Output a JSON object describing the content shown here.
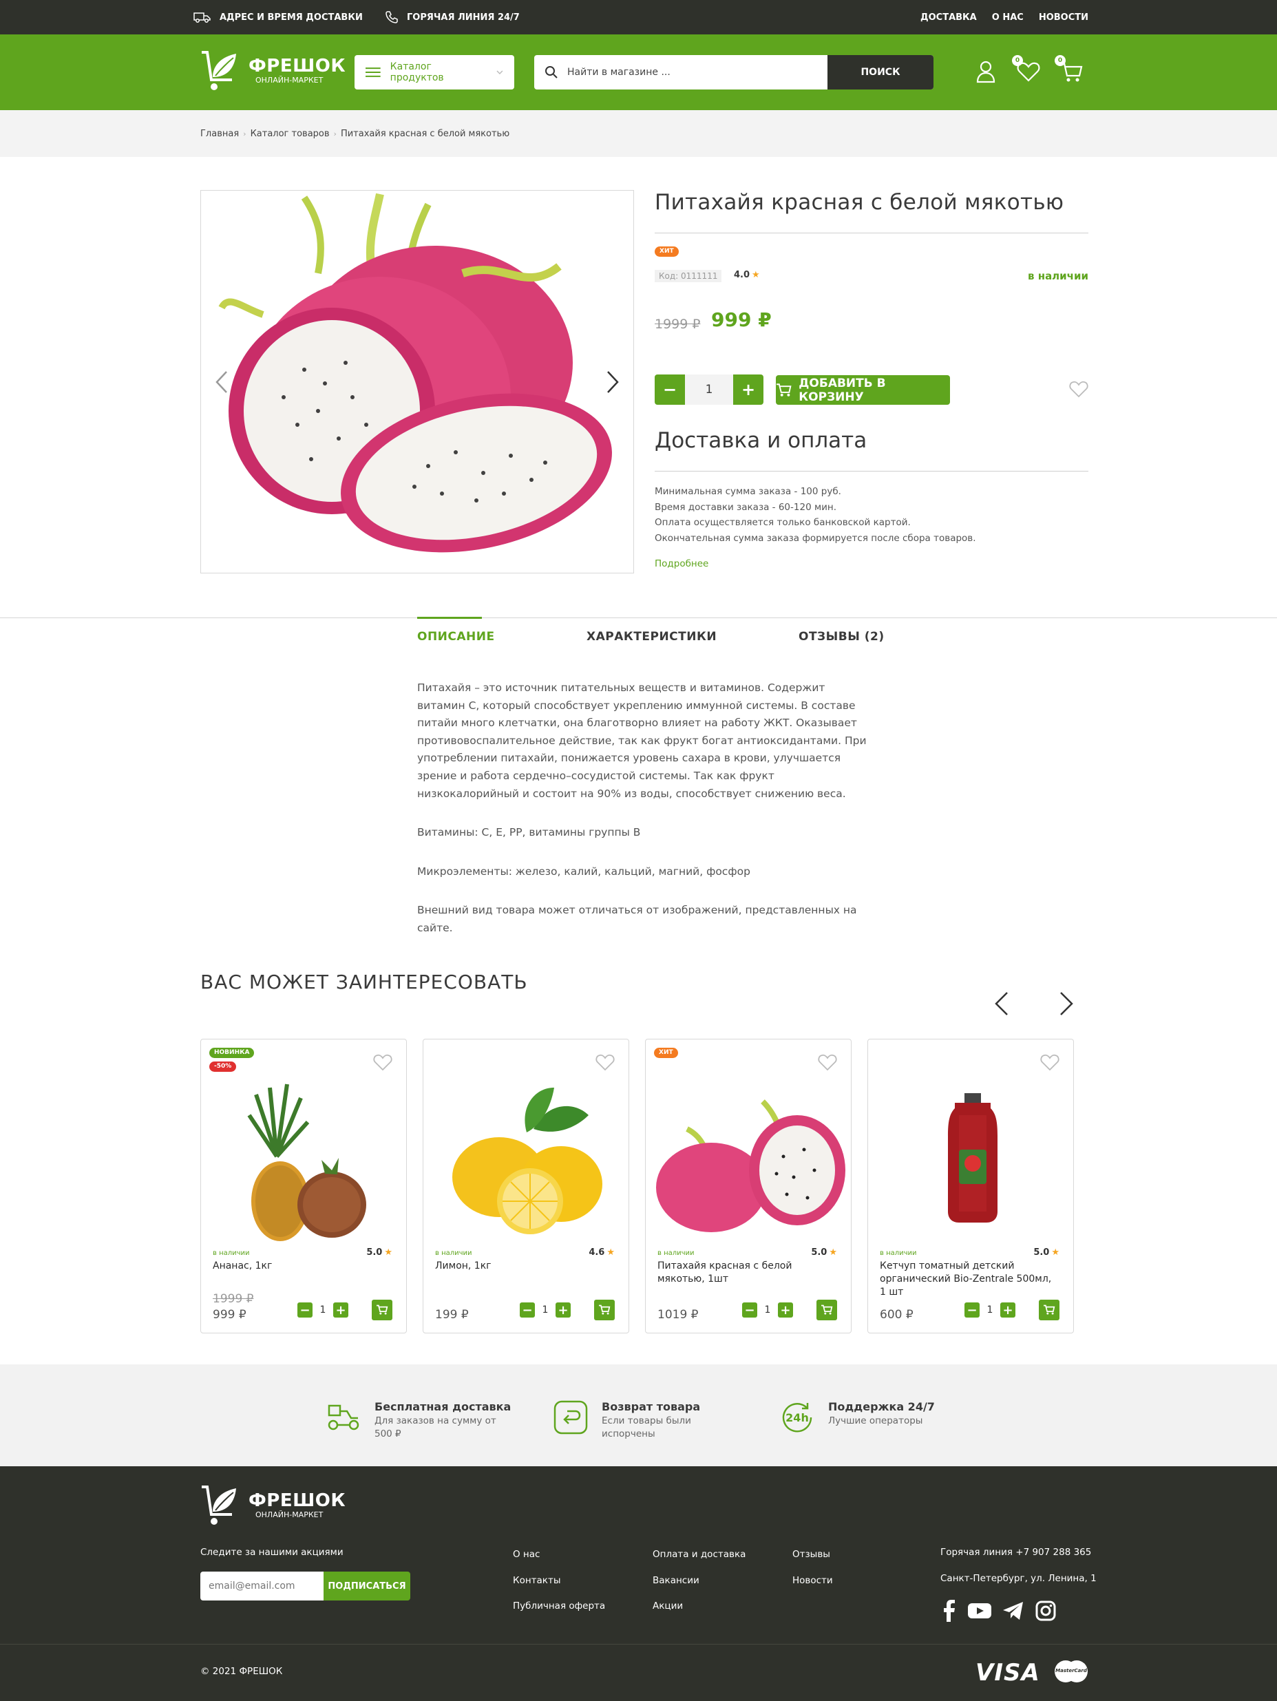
{
  "topbar": {
    "delivery_info": "АДРЕС И ВРЕМЯ ДОСТАВКИ",
    "hotline": "ГОРЯЧАЯ ЛИНИЯ 24/7",
    "nav": [
      "ДОСТАВКА",
      "О НАС",
      "НОВОСТИ"
    ]
  },
  "header": {
    "logo_title": "ФРЕШОК",
    "logo_subtitle": "ОНЛАЙН-МАРКЕТ",
    "catalog_label": "Каталог продуктов",
    "search_placeholder": "Найти в магазине ...",
    "search_button": "ПОИСК",
    "favorites_count": "0",
    "cart_count": "0"
  },
  "breadcrumb": [
    "Главная",
    "Каталог товаров",
    "Питахайя красная с белой мякотью"
  ],
  "product": {
    "title": "Питахайя красная с белой мякотью",
    "badge": "ХИТ",
    "code": "Код: 0111111",
    "rating": "4.0",
    "availability": "в наличии",
    "old_price": "1999 ₽",
    "price": "999 ₽",
    "quantity": "1",
    "add_to_cart": "ДОБАВИТЬ В КОРЗИНУ"
  },
  "delivery": {
    "title": "Доставка и оплата",
    "lines": [
      "Минимальная сумма заказа - 100 руб.",
      "Время доставки заказа - 60-120 мин.",
      "Оплата осуществляется только банковской картой.",
      "Окончательная сумма заказа формируется после сбора товаров."
    ],
    "more": "Подробнее"
  },
  "tabs": [
    "ОПИСАНИЕ",
    "ХАРАКТЕРИСТИКИ",
    "ОТЗЫВЫ (2)"
  ],
  "description": {
    "p1": "Питахайя – это источник питательных веществ и витаминов. Содержит витамин С, который способствует укреплению иммунной системы. В составе питайи много клетчатки, она благотворно влияет на работу ЖКТ. Оказывает противовоспалительное действие, так как фрукт богат антиоксидантами. При употреблении питахайи, понижается уровень сахара в крови, улучшается зрение и работа сердечно–сосудистой системы. Так как фрукт низкокалорийный и состоит на 90% из воды, способствует снижению веса.",
    "p2": "Витамины: С, Е, РР, витамины группы В",
    "p3": "Микроэлементы: железо, калий, кальций, магний, фосфор",
    "p4": "Внешний вид товара может отличаться от изображений, представленных на сайте."
  },
  "related": {
    "title": "ВАС МОЖЕТ ЗАИНТЕРЕСОВАТЬ",
    "cards": [
      {
        "badge": "НОВИНКА",
        "discount": "-50%",
        "stock": "в наличии",
        "rating": "5.0",
        "name": "Ананас, 1кг",
        "old_price": "1999 ₽",
        "price": "999 ₽",
        "qty": "1"
      },
      {
        "stock": "в наличии",
        "rating": "4.6",
        "name": "Лимон, 1кг",
        "price": "199 ₽",
        "qty": "1"
      },
      {
        "badge": "ХИТ",
        "stock": "в наличии",
        "rating": "5.0",
        "name": "Питахайя красная с белой мякотью, 1шт",
        "price": "1019 ₽",
        "qty": "1"
      },
      {
        "stock": "в наличии",
        "rating": "5.0",
        "name": "Кетчуп томатный детский органический Bio-Zentrale 500мл, 1 шт",
        "price": "600 ₽",
        "qty": "1"
      }
    ]
  },
  "features": [
    {
      "title": "Бесплатная доставка",
      "text": "Для заказов на сумму от 500 ₽",
      "icon": "scooter-icon"
    },
    {
      "title": "Возврат товара",
      "text": "Если товары были испорчены",
      "icon": "return-icon"
    },
    {
      "title": "Поддержка 24/7",
      "text": "Лучшие операторы",
      "icon": "support-24h-icon"
    }
  ],
  "footer": {
    "logo_title": "ФРЕШОК",
    "logo_subtitle": "ОНЛАЙН-МАРКЕТ",
    "follow": "Следите за нашими акциями",
    "email_placeholder": "email@email.com",
    "subscribe": "ПОДПИСАТЬСЯ",
    "col1": [
      "О нас",
      "Контакты",
      "Публичная оферта"
    ],
    "col2": [
      "Оплата и доставка",
      "Вакансии",
      "Акции"
    ],
    "col3": [
      "Отзывы",
      "Новости"
    ],
    "phone": "Горячая линия +7 907 288 365",
    "address": "Санкт-Петербург, ул. Ленина, 1",
    "copyright": "© 2021 ФРЕШОК",
    "payment_visa": "VISA",
    "payment_mastercard": "MasterCard"
  },
  "colors": {
    "accent": "#5fa51e",
    "dark": "#2f312b",
    "hit": "#f47b20",
    "discount": "#e0302f"
  }
}
